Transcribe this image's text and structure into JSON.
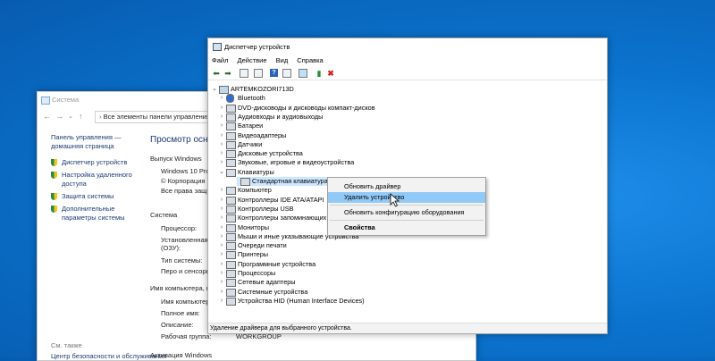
{
  "system_window": {
    "title": "Система",
    "address": "Все элементы панели управления",
    "left_home": "Панель управления — домашняя страница",
    "left_links": [
      {
        "label": "Диспетчер устройств"
      },
      {
        "label": "Настройка удаленного доступа"
      },
      {
        "label": "Защита системы"
      },
      {
        "label": "Дополнительные параметры системы"
      }
    ],
    "see_also": "См. также",
    "bottom_link": "Центр безопасности и обслуживания",
    "heading": "Просмотр основ",
    "edition_section": "Выпуск Windows",
    "edition_lines": [
      "Windows 10 Pro",
      "© Корпорация М",
      "Все права защищ"
    ],
    "system_section": "Система",
    "system_fields": [
      "Процессор:",
      "Установленная п",
      "(ОЗУ):",
      "Тип системы:",
      "Перо и сенсоры"
    ],
    "name_section": "Имя компьютера, им",
    "name_fields": [
      "Имя компьютера:",
      "Полное имя:",
      "Описание:",
      "Рабочая группа:"
    ],
    "workgroup_value": "WORKGROUP",
    "activation_section": "Активация Windows"
  },
  "device_manager": {
    "title": "Диспетчер устройств",
    "menu": [
      "Файл",
      "Действие",
      "Вид",
      "Справка"
    ],
    "root": "ARTEMKOZORI713D",
    "categories": [
      {
        "label": "Bluetooth",
        "icon": "bluetooth-icon"
      },
      {
        "label": "DVD-дисководы и дисководы компакт-дисков",
        "icon": "dvd-icon"
      },
      {
        "label": "Аудиовходы и аудиовыходы",
        "icon": "audio-icon"
      },
      {
        "label": "Батареи",
        "icon": "battery-icon"
      },
      {
        "label": "Видеоадаптеры",
        "icon": "display-adapter-icon"
      },
      {
        "label": "Датчики",
        "icon": "sensor-icon"
      },
      {
        "label": "Дисковые устройства",
        "icon": "disk-icon"
      },
      {
        "label": "Звуковые, игровые и видеоустройства",
        "icon": "sound-icon"
      },
      {
        "label": "Клавиатуры",
        "icon": "keyboard-icon",
        "expanded": true
      },
      {
        "label": "Стандартная клавиатура PS",
        "icon": "keyboard-icon",
        "child": true
      },
      {
        "label": "Компьютер",
        "icon": "computer-icon"
      },
      {
        "label": "Контроллеры IDE ATA/ATAPI",
        "icon": "ide-icon"
      },
      {
        "label": "Контроллеры USB",
        "icon": "usb-icon"
      },
      {
        "label": "Контроллеры запоминающих устройств",
        "icon": "storage-icon"
      },
      {
        "label": "Мониторы",
        "icon": "monitor-icon"
      },
      {
        "label": "Мыши и иные указывающие устройства",
        "icon": "mouse-icon"
      },
      {
        "label": "Очереди печати",
        "icon": "print-queue-icon"
      },
      {
        "label": "Принтеры",
        "icon": "printer-icon"
      },
      {
        "label": "Программные устройства",
        "icon": "software-device-icon"
      },
      {
        "label": "Процессоры",
        "icon": "cpu-icon"
      },
      {
        "label": "Сетевые адаптеры",
        "icon": "network-icon"
      },
      {
        "label": "Системные устройства",
        "icon": "system-device-icon"
      },
      {
        "label": "Устройства HID (Human Interface Devices)",
        "icon": "hid-icon"
      }
    ],
    "status_text": "Удаление драйвера для выбранного устройства."
  },
  "context_menu": {
    "items": [
      {
        "label": "Обновить драйвер"
      },
      {
        "label": "Удалить устройство",
        "highlighted": true
      },
      {
        "label": "Обновить конфигурацию оборудования"
      },
      {
        "label": "Свойства",
        "bold": true
      }
    ]
  },
  "colors": {
    "desktop": "#0a78d4",
    "highlight": "#91c9f7",
    "selection": "#cce8ff",
    "link": "#1a3a73"
  }
}
